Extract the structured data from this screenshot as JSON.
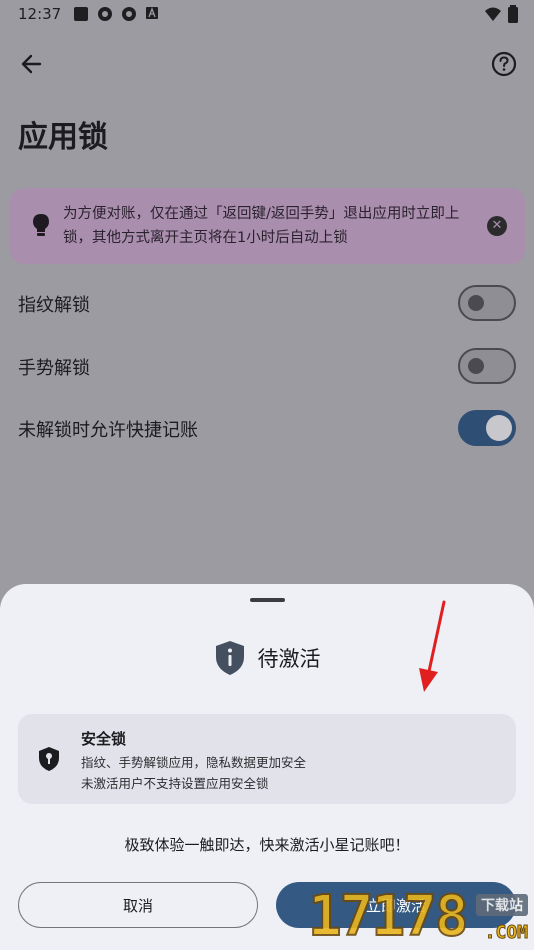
{
  "status_bar": {
    "time": "12:37"
  },
  "header": {
    "back_icon": "arrow-left-icon",
    "help_icon": "help-circle-icon"
  },
  "page": {
    "title": "应用锁"
  },
  "tip": {
    "icon": "lightbulb-icon",
    "text": "为方便对账，仅在通过「返回键/返回手势」退出应用时立即上锁，其他方式离开主页将在1小时后自动上锁",
    "close_glyph": "✕"
  },
  "settings": [
    {
      "label": "指纹解锁",
      "enabled": false
    },
    {
      "label": "手势解锁",
      "enabled": false
    },
    {
      "label": "未解锁时允许快捷记账",
      "enabled": true
    }
  ],
  "sheet": {
    "title": "待激活",
    "icon": "shield-info-icon",
    "feature": {
      "icon": "shield-keyhole-icon",
      "title": "安全锁",
      "desc_line1": "指纹、手势解锁应用，隐私数据更加安全",
      "desc_line2": "未激活用户不支持设置应用安全锁"
    },
    "promo": "极致体验一触即达，快来激活小星记账吧！",
    "cancel_label": "取消",
    "activate_label": "立即激活"
  },
  "watermark": {
    "digits": "17178",
    "top": "下载站",
    "suffix": ".COM"
  },
  "colors": {
    "scrim_bg": "#9c9ba2",
    "tip_bg": "#a98ead",
    "sheet_bg": "#eef0f6",
    "card_bg": "#e2e3ea",
    "accent": "#345a84",
    "arrow": "#e02020"
  }
}
